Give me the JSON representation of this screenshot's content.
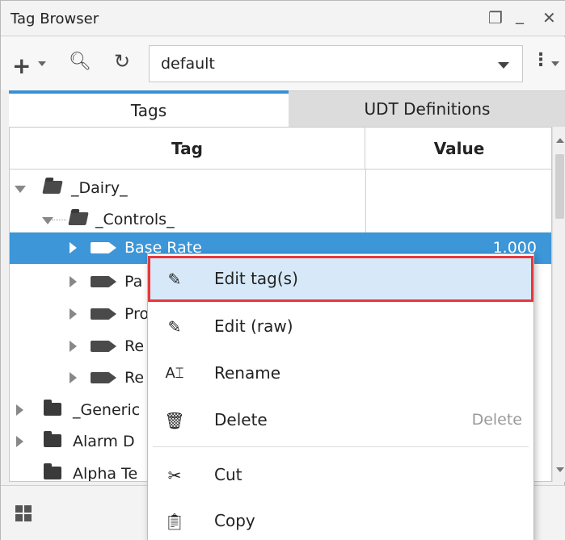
{
  "window": {
    "title": "Tag Browser"
  },
  "toolbar": {
    "provider_value": "default"
  },
  "tabs": [
    {
      "label": "Tags"
    },
    {
      "label": "UDT Definitions"
    }
  ],
  "grid": {
    "columns": {
      "tag": "Tag",
      "value": "Value"
    },
    "rows": [
      {
        "label": "_Dairy_",
        "value": ""
      },
      {
        "label": "_Controls_",
        "value": ""
      },
      {
        "label": "Base Rate",
        "value": "1.000"
      },
      {
        "label": "Pa",
        "value": ""
      },
      {
        "label": "Pro",
        "value": ""
      },
      {
        "label": "Re",
        "value": ""
      },
      {
        "label": "Re",
        "value": ""
      },
      {
        "label": "_Generic",
        "value": ""
      },
      {
        "label": "Alarm D",
        "value": ""
      },
      {
        "label": "Alpha Te",
        "value": ""
      }
    ]
  },
  "context_menu": {
    "items": [
      {
        "label": "Edit tag(s)",
        "shortcut": "",
        "icon": "pencil-icon"
      },
      {
        "label": "Edit (raw)",
        "shortcut": "",
        "icon": "pencil-icon"
      },
      {
        "label": "Rename",
        "shortcut": "",
        "icon": "rename-icon"
      },
      {
        "label": "Delete",
        "shortcut": "Delete",
        "icon": "trash-icon"
      },
      {
        "label": "Cut",
        "shortcut": "",
        "icon": "scissors-icon"
      },
      {
        "label": "Copy",
        "shortcut": "",
        "icon": "clipboard-icon"
      }
    ],
    "highlight_color": "#e5383b"
  },
  "colors": {
    "selection": "#3c96d8",
    "tab_accent": "#3a8fd6"
  }
}
